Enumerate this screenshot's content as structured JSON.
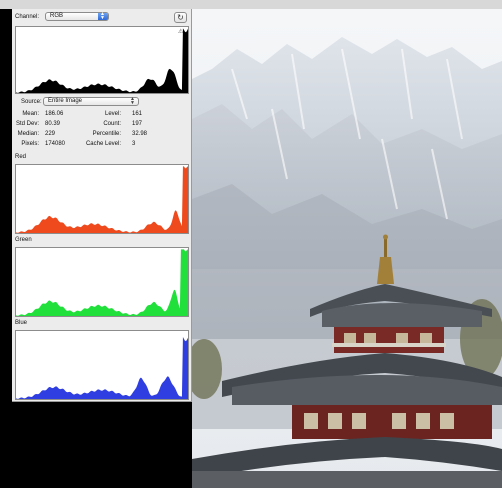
{
  "panel": {
    "channel_label": "Channel:",
    "channel_value": "RGB",
    "refresh_icon": "refresh-icon",
    "source_label": "Source:",
    "source_value": "Entire Image",
    "warning_icon": "cache-warning-icon",
    "stats": {
      "mean_label": "Mean:",
      "mean_value": "186.06",
      "stddev_label": "Std Dev:",
      "stddev_value": "80.39",
      "median_label": "Median:",
      "median_value": "229",
      "pixels_label": "Pixels:",
      "pixels_value": "174080",
      "level_label": "Level:",
      "level_value": "161",
      "count_label": "Count:",
      "count_value": "197",
      "percentile_label": "Percentile:",
      "percentile_value": "32.98",
      "cache_label": "Cache Level:",
      "cache_value": "3"
    },
    "sections": {
      "red": "Red",
      "green": "Green",
      "blue": "Blue"
    }
  },
  "colors": {
    "composite": "#000000",
    "red": "#ee4a1e",
    "green": "#22e03c",
    "blue": "#2f3ee0",
    "select_accent": "#2f6ad6"
  }
}
